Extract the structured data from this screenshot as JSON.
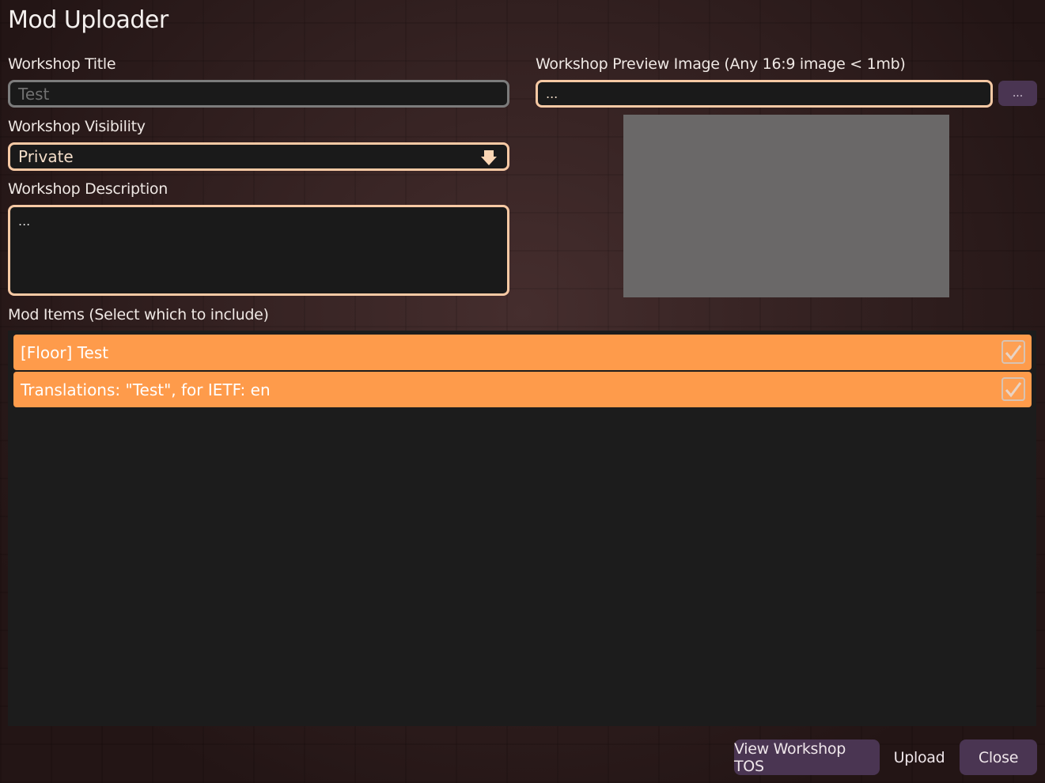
{
  "app": {
    "title": "Mod Uploader"
  },
  "workshop_title": {
    "label": "Workshop Title",
    "value": "Test"
  },
  "workshop_visibility": {
    "label": "Workshop Visibility",
    "value": "Private"
  },
  "workshop_description": {
    "label": "Workshop Description",
    "value": "..."
  },
  "preview_image": {
    "label": "Workshop Preview Image (Any 16:9 image < 1mb)",
    "value": "...",
    "browse_label": "..."
  },
  "mod_items": {
    "label": "Mod Items (Select which to include)",
    "items": [
      {
        "label": "[Floor] Test",
        "checked": true
      },
      {
        "label": "Translations: \"Test\", for IETF: en",
        "checked": true
      }
    ]
  },
  "footer": {
    "tos_label": "View Workshop TOS",
    "upload_label": "Upload",
    "close_label": "Close"
  },
  "colors": {
    "accent": "#fe9b4b",
    "field_border": "#f7c9a4",
    "button_bg": "#4a3552",
    "panel_bg": "#1c1c1c"
  }
}
